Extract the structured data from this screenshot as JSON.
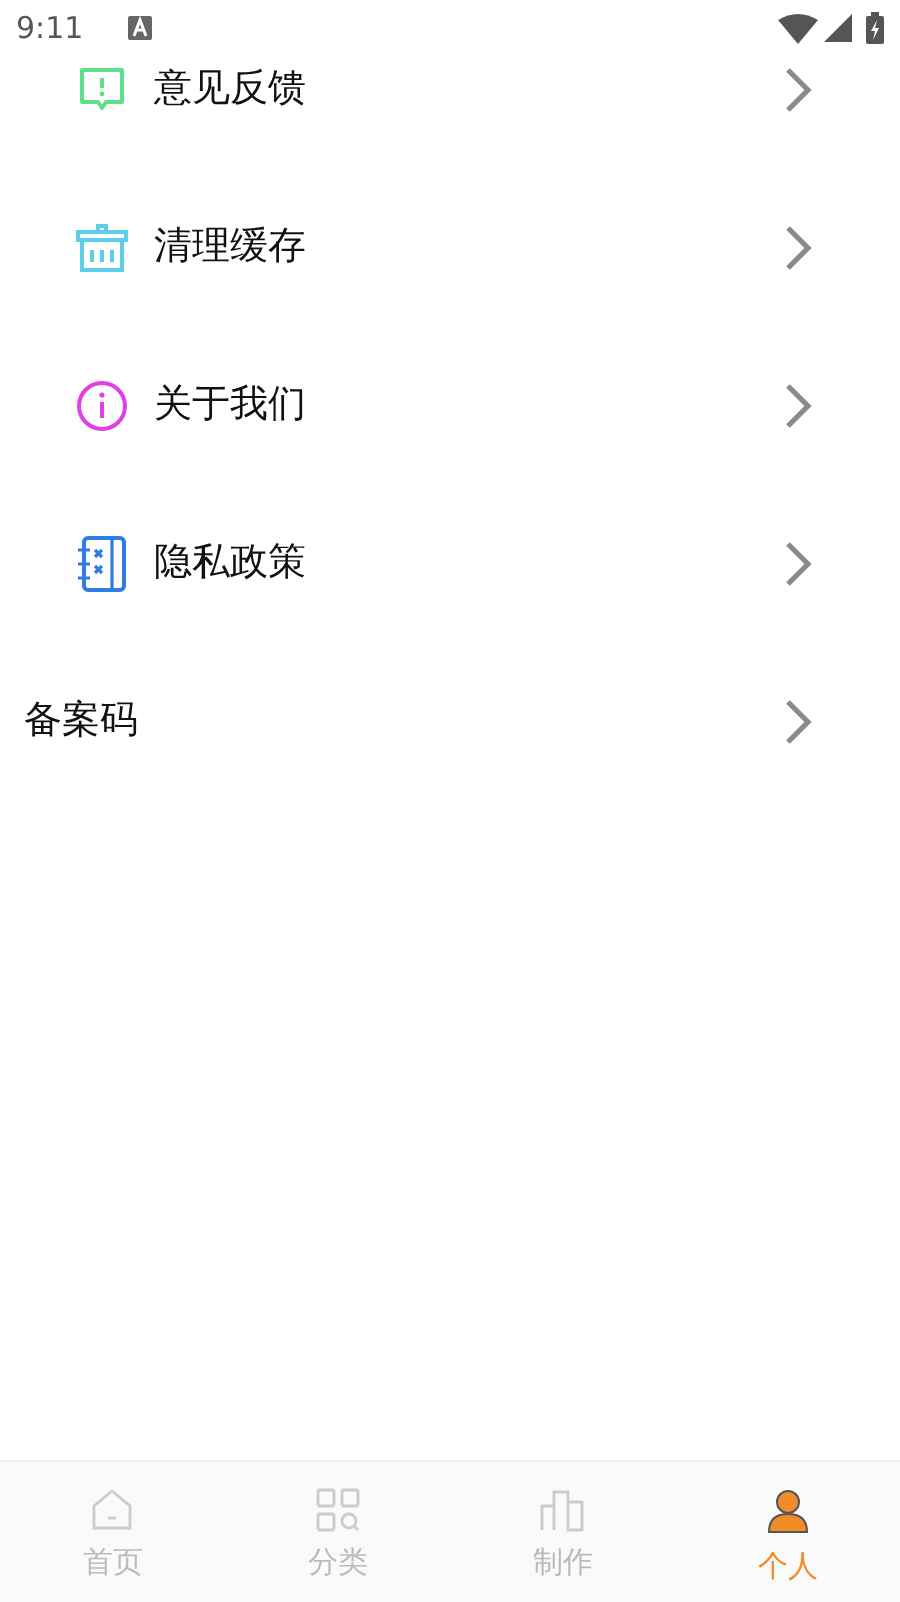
{
  "status_bar": {
    "time": "9:11"
  },
  "menu": [
    {
      "kind": "icon",
      "label": "意见反馈",
      "color": "#5ee08a"
    },
    {
      "kind": "icon",
      "label": "清理缓存",
      "color": "#5bcfe8"
    },
    {
      "kind": "icon",
      "label": "关于我们",
      "color": "#e040e8"
    },
    {
      "kind": "icon",
      "label": "隐私政策",
      "color": "#2f7de1"
    },
    {
      "kind": "plain",
      "label": "备案码"
    }
  ],
  "tabs": [
    {
      "label": "首页",
      "selected": false
    },
    {
      "label": "分类",
      "selected": false
    },
    {
      "label": "制作",
      "selected": false
    },
    {
      "label": "个人",
      "selected": true
    }
  ]
}
